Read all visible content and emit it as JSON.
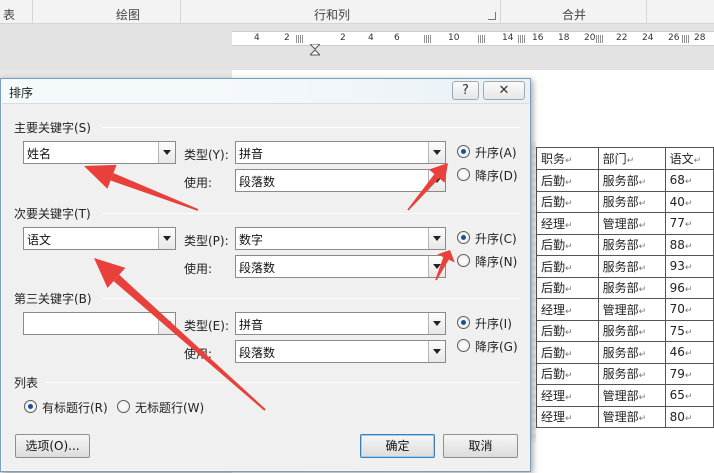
{
  "ribbon": {
    "groups": [
      "表",
      "绘图",
      "行和列",
      "合并"
    ]
  },
  "ruler": {
    "ticks": [
      "4",
      "2",
      "2",
      "4",
      "6",
      "10",
      "14",
      "16",
      "18",
      "20",
      "22",
      "24",
      "26",
      "28"
    ]
  },
  "dialog": {
    "title": "排序",
    "help_label": "?",
    "close_label": "✕",
    "primary": {
      "section": "主要关键字(S)",
      "key": "姓名",
      "type_label": "类型(Y):",
      "type_value": "拼音",
      "using_label": "使用:",
      "using_value": "段落数",
      "asc_label": "升序(A)",
      "desc_label": "降序(D)",
      "order": "asc"
    },
    "secondary": {
      "section": "次要关键字(T)",
      "key": "语文",
      "type_label": "类型(P):",
      "type_value": "数字",
      "using_label": "使用:",
      "using_value": "段落数",
      "asc_label": "升序(C)",
      "desc_label": "降序(N)",
      "order": "asc"
    },
    "tertiary": {
      "section": "第三关键字(B)",
      "key": "",
      "type_label": "类型(E):",
      "type_value": "拼音",
      "using_label": "使用:",
      "using_value": "段落数",
      "asc_label": "升序(I)",
      "desc_label": "降序(G)",
      "order": "asc"
    },
    "list_section": "列表",
    "header_row_label": "有标题行(R)",
    "no_header_row_label": "无标题行(W)",
    "header_mode": "with_header",
    "options_button": "选项(O)...",
    "ok_button": "确定",
    "cancel_button": "取消"
  },
  "table": {
    "para_mark": "↵",
    "rows": [
      [
        "职务",
        "部门",
        "语文"
      ],
      [
        "后勤",
        "服务部",
        "68"
      ],
      [
        "后勤",
        "服务部",
        "40"
      ],
      [
        "经理",
        "管理部",
        "77"
      ],
      [
        "后勤",
        "服务部",
        "88"
      ],
      [
        "后勤",
        "服务部",
        "93"
      ],
      [
        "后勤",
        "服务部",
        "96"
      ],
      [
        "经理",
        "管理部",
        "70"
      ],
      [
        "后勤",
        "服务部",
        "75"
      ],
      [
        "后勤",
        "服务部",
        "46"
      ],
      [
        "后勤",
        "服务部",
        "79"
      ],
      [
        "经理",
        "管理部",
        "65"
      ],
      [
        "经理",
        "管理部",
        "80"
      ]
    ]
  },
  "annotation_color": "#e8403a"
}
